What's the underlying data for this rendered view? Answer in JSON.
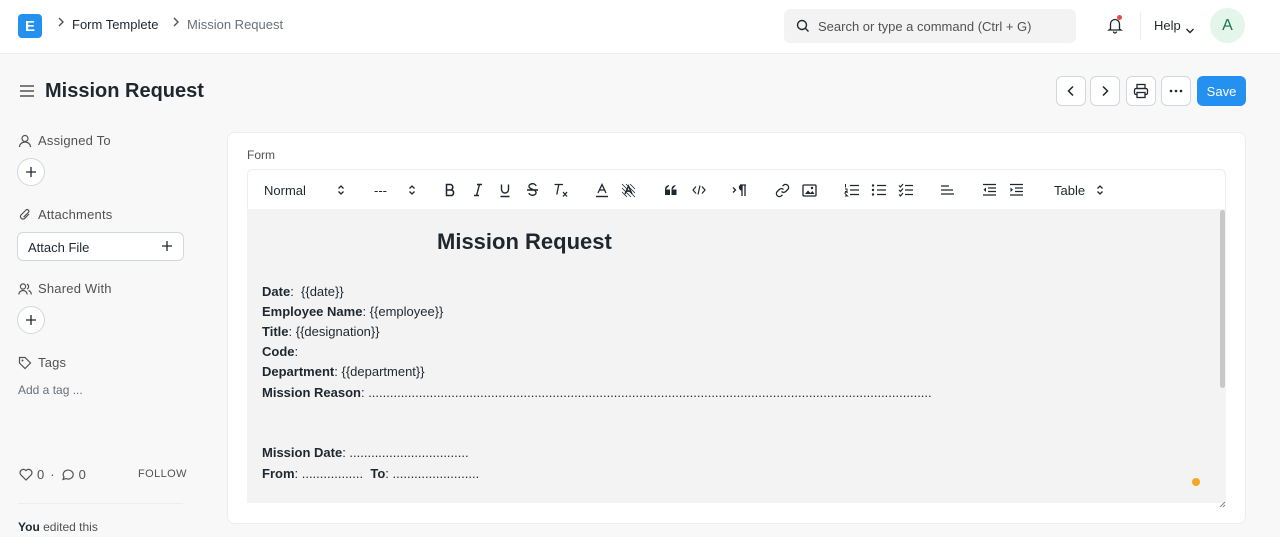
{
  "nav": {
    "logo": "E",
    "breadcrumbs": [
      "Form Templete",
      "Mission Request"
    ],
    "search_placeholder": "Search or type a command (Ctrl + G)",
    "help": "Help",
    "avatar": "A"
  },
  "page": {
    "title": "Mission Request",
    "save": "Save"
  },
  "sidebar": {
    "assigned_to": "Assigned To",
    "attachments": "Attachments",
    "attach_file": "Attach File",
    "shared_with": "Shared With",
    "tags": "Tags",
    "add_tag": "Add a tag ...",
    "likes": "0",
    "comments": "0",
    "follow": "FOLLOW",
    "activity_user": "You",
    "activity_text": " edited this"
  },
  "form": {
    "field_label": "Form",
    "toolbar": {
      "paragraph_style": "Normal",
      "font_size": "---",
      "table": "Table"
    },
    "doc_title": "Mission Request",
    "lines": [
      {
        "label": "Date",
        "value": ":  {{date}}"
      },
      {
        "label": "Employee Name",
        "value": ": {{employee}}"
      },
      {
        "label": "Title",
        "value": ": {{designation}}"
      },
      {
        "label": "Code",
        "value": ":"
      },
      {
        "label": "Department",
        "value": ": {{department}}"
      },
      {
        "label": "Mission Reason",
        "value": ": ............................................................................................................................................................"
      },
      {
        "label": "Mission Date",
        "value": ": ................................."
      },
      {
        "label": "From",
        "value": ": .................  "
      },
      {
        "label": "To",
        "value": ": ........................"
      }
    ]
  },
  "colors": {
    "primary": "#2490ef",
    "text": "#1f272e",
    "muted": "#525252",
    "editor_bg": "#f3f3f3",
    "indicator": "#f5a623"
  }
}
